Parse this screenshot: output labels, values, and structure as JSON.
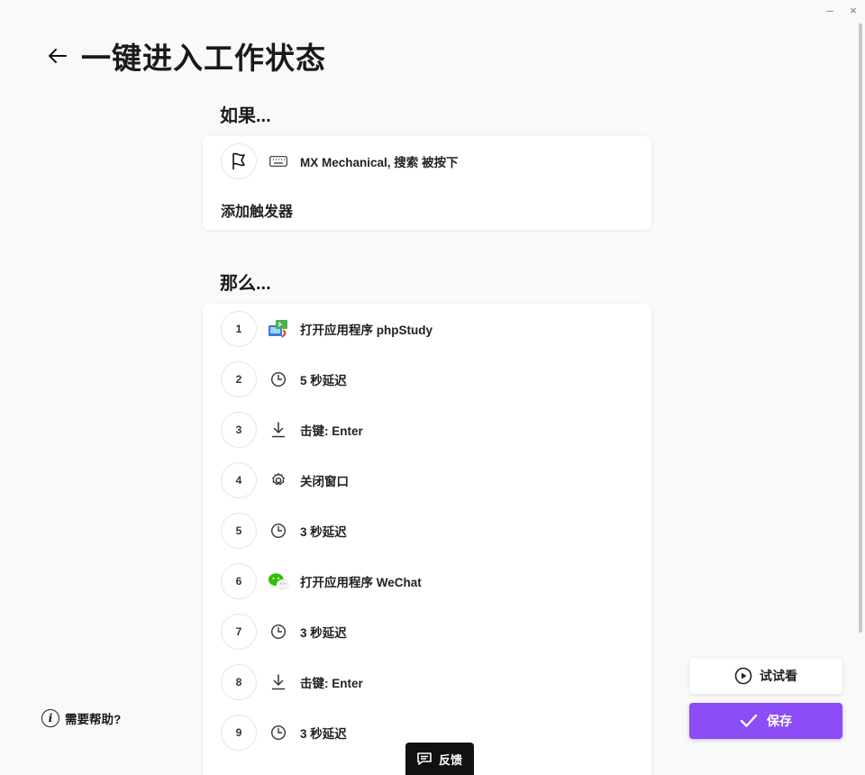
{
  "window": {
    "minimize": "–",
    "close": "×"
  },
  "header": {
    "title": "一键进入工作状态"
  },
  "if_section": {
    "title": "如果...",
    "trigger": {
      "text": "MX Mechanical, 搜索 被按下",
      "icon": "keyboard-icon"
    },
    "add_trigger": "添加触发器"
  },
  "then_section": {
    "title": "那么...",
    "actions": [
      {
        "num": "1",
        "text": "打开应用程序 phpStudy",
        "icon": "phpstudy-app-icon"
      },
      {
        "num": "2",
        "text": "5 秒延迟",
        "icon": "clock-icon"
      },
      {
        "num": "3",
        "text": "击键: Enter",
        "icon": "download-arrow-icon"
      },
      {
        "num": "4",
        "text": "关闭窗口",
        "icon": "gear-icon"
      },
      {
        "num": "5",
        "text": "3 秒延迟",
        "icon": "clock-icon"
      },
      {
        "num": "6",
        "text": "打开应用程序 WeChat",
        "icon": "wechat-app-icon"
      },
      {
        "num": "7",
        "text": "3 秒延迟",
        "icon": "clock-icon"
      },
      {
        "num": "8",
        "text": "击键: Enter",
        "icon": "download-arrow-icon"
      },
      {
        "num": "9",
        "text": "3 秒延迟",
        "icon": "clock-icon"
      }
    ]
  },
  "help": {
    "label": "需要帮助?"
  },
  "buttons": {
    "try": "试试看",
    "save": "保存"
  },
  "feedback": {
    "label": "反馈"
  },
  "colors": {
    "accent": "#8a4df6",
    "background": "#f9f9f9"
  }
}
